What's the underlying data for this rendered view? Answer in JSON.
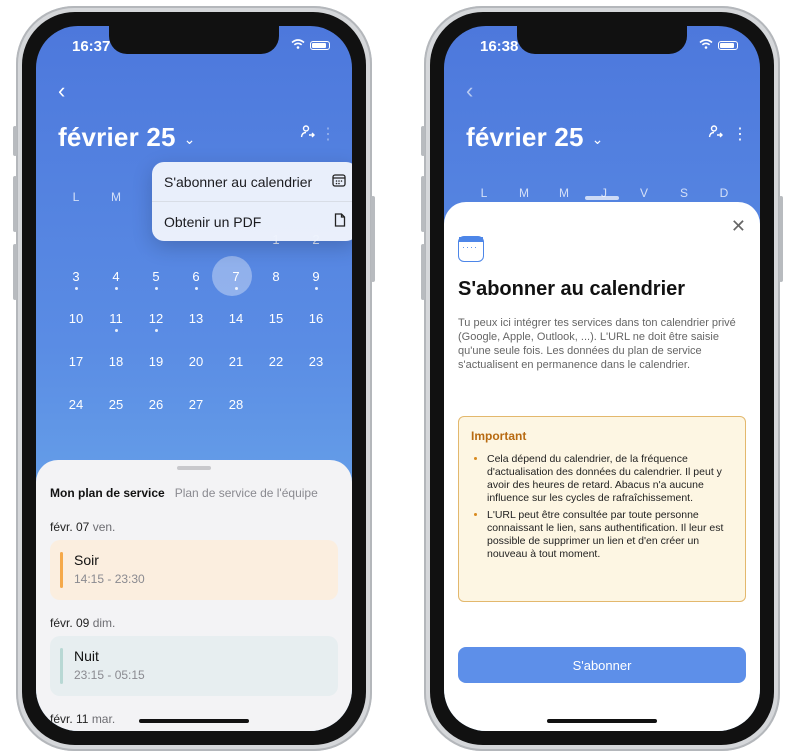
{
  "left": {
    "status_time": "16:37",
    "month_title": "février 25",
    "weekdays": [
      "L",
      "M"
    ],
    "menu": [
      {
        "label": "S'abonner au calendrier",
        "icon": "calendar-grid-icon"
      },
      {
        "label": "Obtenir un PDF",
        "icon": "document-icon"
      }
    ],
    "partial_row": [
      "1",
      "2"
    ],
    "rows": [
      [
        "3",
        "4",
        "5",
        "6",
        "7",
        "8",
        "9"
      ],
      [
        "10",
        "11",
        "12",
        "13",
        "14",
        "15",
        "16"
      ],
      [
        "17",
        "18",
        "19",
        "20",
        "21",
        "22",
        "23"
      ],
      [
        "24",
        "25",
        "26",
        "27",
        "28"
      ]
    ],
    "selected_day": "7",
    "tabs": {
      "active": "Mon plan de service",
      "inactive": "Plan de service de l'équipe"
    },
    "days": [
      {
        "date": "févr. 07",
        "weekday": "ven."
      },
      {
        "date": "févr. 09",
        "weekday": "dim."
      },
      {
        "date": "févr. 11",
        "weekday": "mar."
      }
    ],
    "shifts": [
      {
        "name": "Soir",
        "time": "14:15 - 23:30",
        "bg": "#fbeedf",
        "bar": "#f5a94a"
      },
      {
        "name": "Nuit",
        "time": "23:15 - 05:15",
        "bg": "#e7eef0",
        "bar": "#b8d8d4"
      }
    ]
  },
  "right": {
    "status_time": "16:38",
    "month_title": "février 25",
    "weekdays": [
      "L",
      "M",
      "M",
      "J",
      "V",
      "S",
      "D"
    ],
    "modal_title": "S'abonner au calendrier",
    "modal_desc": "Tu peux ici intégrer tes services dans ton calendrier privé (Google, Apple, Outlook, ...). L'URL ne doit être saisie qu'une seule fois. Les données du plan de service s'actualisent en permanence dans le calendrier.",
    "important_title": "Important",
    "important_items": [
      "Cela dépend du calendrier, de la fréquence d'actualisation des données du calendrier. Il peut y avoir des heures de retard. Abacus n'a aucune influence sur les cycles de rafraîchissement.",
      "L'URL peut être consultée par toute personne connaissant le lien, sans authentification. Il leur est possible de supprimer un lien et d'en créer un nouveau à tout moment."
    ],
    "button": "S'abonner"
  },
  "colors": {
    "accent": "#5d8fe9",
    "important_border": "#e3b86d",
    "important_title": "#b86a11"
  }
}
